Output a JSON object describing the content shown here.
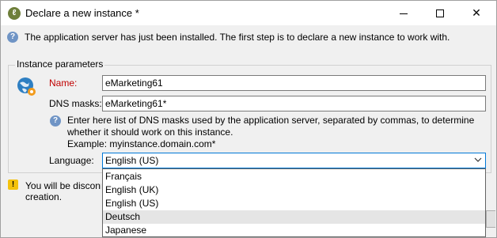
{
  "window": {
    "title": "Declare a new instance *",
    "app_icon": "app-logo-icon",
    "controls": {
      "minimize": "minimize-icon",
      "maximize": "maximize-icon",
      "close": "✕"
    }
  },
  "intro": {
    "icon": "question-icon",
    "text": "The application server has just been installed. The first step is to declare a new instance to work with."
  },
  "instance_parameters": {
    "group_label": "Instance parameters",
    "icon": "globe-gear-icon",
    "name_label": "Name:",
    "name_value": "eMarketing61",
    "dns_label": "DNS masks:",
    "dns_value": "eMarketing61*",
    "hint_icon": "question-icon",
    "hint_text": "Enter here list of DNS masks used by the application server, separated by commas, to determine whether it should work on this instance.",
    "example_text": "Example: myinstance.domain.com*",
    "language_label": "Language:",
    "language_value": "English (US)",
    "language_options": [
      "Français",
      "English (UK)",
      "English (US)",
      "Deutsch",
      "Japanese"
    ],
    "hovered_option": "Deutsch"
  },
  "warning": {
    "icon": "warning-icon",
    "text_line1": "You will be disconn",
    "text_line2": "creation."
  },
  "colors": {
    "accent": "#0078d7",
    "required_label": "#c00000",
    "info_icon": "#6f94c5",
    "warning_icon": "#f4c20d"
  }
}
